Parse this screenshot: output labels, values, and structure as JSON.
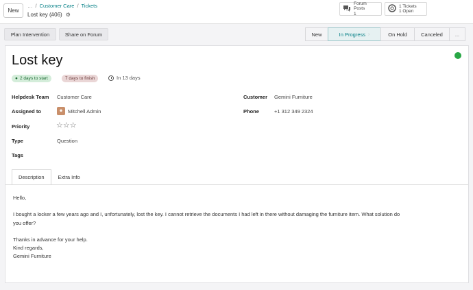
{
  "topbar": {
    "new_label": "New",
    "breadcrumb": {
      "dots": "…",
      "sep1": "/",
      "item1": "Customer Care",
      "sep2": "/",
      "item2": "Tickets"
    },
    "record_name": "Lost key (#06)",
    "stats": [
      {
        "icon": "chat-bubbles-icon",
        "label": "Forum Posts",
        "count": "1"
      },
      {
        "icon": "lifebuoy-icon",
        "label": "1 Tickets",
        "count": "1 Open"
      }
    ]
  },
  "actions": {
    "plan_intervention": "Plan Intervention",
    "share_on_forum": "Share on Forum"
  },
  "stages": [
    "New",
    "In Progress",
    "On Hold",
    "Canceled",
    "..."
  ],
  "active_stage": "In Progress",
  "ticket": {
    "title": "Lost key",
    "badge_start": "2 days to start",
    "badge_finish": "7 days to finish",
    "deadline": "In 13 days",
    "status_color": "#28a745",
    "fields": {
      "team_label": "Helpdesk Team",
      "team_value": "Customer Care",
      "assigned_label": "Assigned to",
      "assigned_value": "Mitchell Admin",
      "priority_label": "Priority",
      "priority_stars": "☆☆☆",
      "type_label": "Type",
      "type_value": "Question",
      "tags_label": "Tags",
      "customer_label": "Customer",
      "customer_value": "Gemini Furniture",
      "phone_label": "Phone",
      "phone_value": "+1 312 349 2324"
    },
    "tabs": [
      "Description",
      "Extra Info"
    ],
    "description": {
      "line1": "Hello,",
      "line2": "I bought a locker a few years ago and I, unfortunately, lost the key. I cannot retrieve the documents I had left in there without damaging the furniture item. What solution do",
      "line3": "you offer?",
      "line4": "Thanks in advance for your help.",
      "line5": "Kind regards,",
      "line6": "Gemini Furniture"
    }
  },
  "colors": {
    "accent": "#017e84",
    "green_badge": "#d4edda",
    "pink_badge": "#ead6d6"
  }
}
